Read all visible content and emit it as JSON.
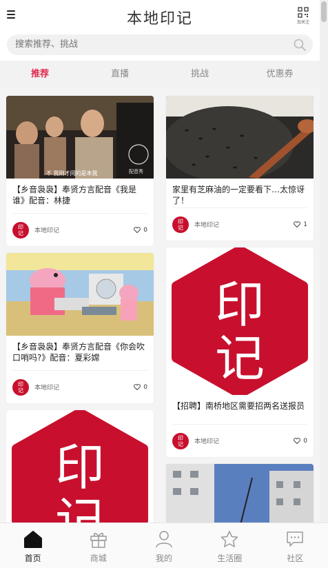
{
  "header": {
    "title": "本地印记",
    "qr_label": "加关注"
  },
  "search": {
    "placeholder": "搜索推荐、挑战"
  },
  "tabs": [
    {
      "label": "推荐",
      "active": true
    },
    {
      "label": "直播",
      "active": false
    },
    {
      "label": "挑战",
      "active": false
    },
    {
      "label": "优惠券",
      "active": false
    }
  ],
  "feed": {
    "left": [
      {
        "title": "【乡音袅袅】奉贤方言配音《我是谁》配音：林捷",
        "author": "本地印记",
        "likes": "0",
        "image": "drama-still",
        "subtitle": "不 我刚才问的是本我",
        "watermark": "配音秀"
      },
      {
        "title": "【乡音袅袅】奉贤方言配音《你会吹口哨吗?》配音：夏彩嫦",
        "author": "本地印记",
        "likes": "0",
        "image": "cartoon-still"
      },
      {
        "title": "",
        "author": "",
        "likes": "",
        "image": "brand-logo"
      }
    ],
    "right": [
      {
        "title": "家里有芝麻油的一定要看下…太惊讶了！",
        "author": "本地印记",
        "likes": "1",
        "image": "sesame-photo"
      },
      {
        "title": "【招聘】南桥地区需要招两名送报员",
        "author": "本地印记",
        "likes": "0",
        "image": "brand-logo"
      },
      {
        "title": "",
        "author": "",
        "likes": "",
        "image": "building-photo"
      }
    ]
  },
  "brand": {
    "logo_text_1": "印",
    "logo_text_2": "记",
    "color": "#c8102e"
  },
  "avatar_text": {
    "line1": "印",
    "line2": "记"
  },
  "bottom_nav": [
    {
      "label": "首页",
      "icon": "home-icon",
      "active": true
    },
    {
      "label": "商城",
      "icon": "gift-icon",
      "active": false
    },
    {
      "label": "我的",
      "icon": "user-icon",
      "active": false
    },
    {
      "label": "生活圈",
      "icon": "star-icon",
      "active": false
    },
    {
      "label": "社区",
      "icon": "chat-icon",
      "active": false
    }
  ],
  "colors": {
    "accent": "#e0284f",
    "brand_red": "#c8102e",
    "tab_bg": "#f2f2f2",
    "feed_bg": "#f4f4f4"
  }
}
